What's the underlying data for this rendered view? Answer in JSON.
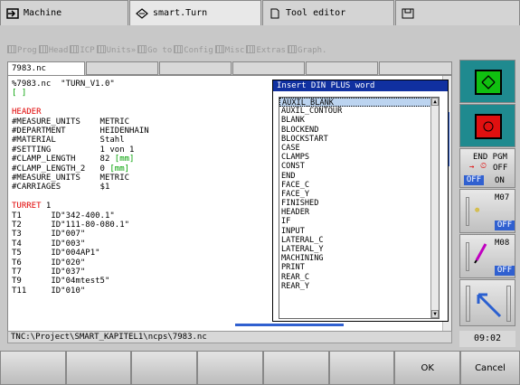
{
  "top_tabs": [
    {
      "label": "Machine",
      "icon": "arrow-into-box-icon"
    },
    {
      "label": "smart.Turn",
      "icon": "diamond-arrows-icon"
    },
    {
      "label": "Tool editor",
      "icon": "document-icon"
    },
    {
      "label": "",
      "icon": "floppy-icon"
    }
  ],
  "menu": [
    "Prog",
    "Head",
    "ICP",
    "Units»",
    "Go to",
    "Config",
    "Misc",
    "Extras",
    "Graph."
  ],
  "doc_tab": "7983.nc",
  "editor_lines": [
    {
      "t": "%7983.nc  \"TURN_V1.0\"",
      "c": ""
    },
    {
      "t": "[ ]",
      "c": "green"
    },
    {
      "t": "",
      "c": ""
    },
    {
      "t": "HEADER",
      "c": "red"
    },
    {
      "t": "#MEASURE_UNITS    METRIC",
      "c": ""
    },
    {
      "t": "#DEPARTMENT       HEIDENHAIN",
      "c": ""
    },
    {
      "t": "#MATERIAL         Stahl",
      "c": ""
    },
    {
      "t": "#SETTING          1 von 1",
      "c": ""
    },
    {
      "t": "#CLAMP_LENGTH     82 ",
      "c": "",
      "g": "[mm]"
    },
    {
      "t": "#CLAMP_LENGTH_2   0 ",
      "c": "",
      "g": "[mm]"
    },
    {
      "t": "#MEASURE_UNITS    METRIC",
      "c": ""
    },
    {
      "t": "#CARRIAGES        $1",
      "c": ""
    },
    {
      "t": "",
      "c": ""
    },
    {
      "t": "TURRET",
      "c": "red",
      "suffix": " 1"
    },
    {
      "t": "T1      ID\"342-400.1\"",
      "c": ""
    },
    {
      "t": "T2      ID\"111-80-080.1\"",
      "c": ""
    },
    {
      "t": "T3      ID\"007\"",
      "c": ""
    },
    {
      "t": "T4      ID\"003\"",
      "c": ""
    },
    {
      "t": "T5      ID\"004AP1\"",
      "c": ""
    },
    {
      "t": "T6      ID\"020\"",
      "c": ""
    },
    {
      "t": "T7      ID\"037\"",
      "c": ""
    },
    {
      "t": "T9      ID\"04mtest5\"",
      "c": ""
    },
    {
      "t": "T11     ID\"010\"",
      "c": ""
    }
  ],
  "popup": {
    "title": "Insert DIN PLUS word",
    "items": [
      "AUXIL_BLANK",
      "AUXIL_CONTOUR",
      "BLANK",
      "BLOCKEND",
      "BLOCKSTART",
      "CASE",
      "CLAMPS",
      "CONST",
      "END",
      "FACE_C",
      "FACE_Y",
      "FINISHED",
      "HEADER",
      "IF",
      "INPUT",
      "LATERAL_C",
      "LATERAL_Y",
      "MACHINING",
      "PRINT",
      "REAR_C",
      "REAR_Y"
    ],
    "selected_index": 0
  },
  "status_path": "TNC:\\Project\\SMART_KAPITEL1\\ncps\\7983.nc",
  "clock": "09:02",
  "right_panel": {
    "end_pgm": "END PGM",
    "off_label": "OFF",
    "on_label": "ON",
    "m07": "M07",
    "m08": "M08",
    "m07_state": "OFF",
    "m08_state": "OFF"
  },
  "softkeys": [
    "",
    "",
    "",
    "",
    "",
    "",
    "OK",
    "Cancel"
  ]
}
